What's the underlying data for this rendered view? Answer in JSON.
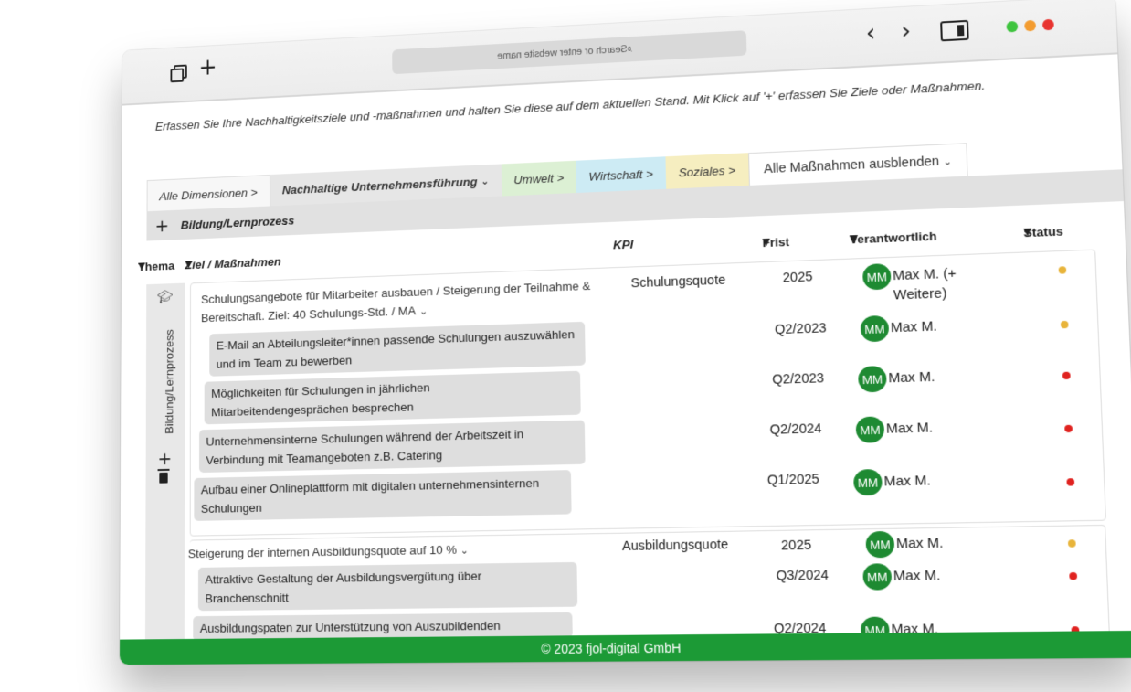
{
  "browser": {
    "address_placeholder": "Search or enter website name",
    "icons": [
      "tabs-icon",
      "new-tab-icon",
      "back-icon",
      "forward-icon",
      "sidebar-icon"
    ],
    "window_dots": [
      "#3fc43f",
      "#f39c30",
      "#e8332f"
    ]
  },
  "intro": "Erfassen Sie Ihre Nachhaltigkeitsziele und -maßnahmen und halten Sie diese auf dem aktuellen Stand. Mit Klick auf '+' erfassen Sie Ziele oder Maßnahmen.",
  "tabs": {
    "all": "Alle Dimensionen >",
    "nu": "Nachhaltige Unternehmensführung",
    "um": "Umwelt >",
    "wi": "Wirtschaft >",
    "so": "Soziales >",
    "hide": "Alle Maßnahmen ausblenden"
  },
  "subbar": {
    "add": "+",
    "label": "Bildung/Lernprozess"
  },
  "table_header": {
    "thema": "Thema",
    "ziel": "Ziel / Maßnahmen",
    "kpi": "KPI",
    "frist": "Frist",
    "verantwortlich": "Verantwortlich",
    "status": "Status"
  },
  "side": {
    "label": "Bildung/Lernprozess",
    "add": "+"
  },
  "groups": [
    {
      "goal": "Schulungsangebote für Mitarbeiter ausbauen / Steigerung der Teilnahme & Bereitschaft. Ziel: 40 Schulungs-Std. / MA",
      "kpi": "Schulungsquote",
      "frist": "2025",
      "initials": "MM",
      "resp": "Max M. (+ Weitere)",
      "status": "#e8b43a",
      "measures": [
        {
          "text": "E-Mail an Abteilungsleiter*innen passende Schulungen auszuwählen und im Team zu bewerben",
          "frist": "Q2/2023",
          "initials": "MM",
          "resp": "Max M.",
          "status": "#e8b43a"
        },
        {
          "text": "Möglichkeiten für Schulungen in jährlichen Mitarbeitendengesprächen besprechen",
          "frist": "Q2/2023",
          "initials": "MM",
          "resp": "Max M.",
          "status": "#e0221f"
        },
        {
          "text": "Unternehmensinterne Schulungen während der Arbeitszeit in Verbindung mit Teamangeboten z.B. Catering",
          "frist": "Q2/2024",
          "initials": "MM",
          "resp": "Max M.",
          "status": "#e0221f"
        },
        {
          "text": "Aufbau einer Onlineplattform mit digitalen unternehmensinternen Schulungen",
          "frist": "Q1/2025",
          "initials": "MM",
          "resp": "Max M.",
          "status": "#e0221f"
        }
      ]
    },
    {
      "goal": "Steigerung der internen Ausbildungsquote auf 10 %",
      "kpi": "Ausbildungsquote",
      "frist": "2025",
      "initials": "MM",
      "resp": "Max M.",
      "status": "#e8b43a",
      "measures": [
        {
          "text": "Attraktive Gestaltung der Ausbildungsvergütung über Branchenschnitt",
          "frist": "Q3/2024",
          "initials": "MM",
          "resp": "Max M.",
          "status": "#e0221f"
        },
        {
          "text": "Ausbildungspaten zur Unterstützung von Auszubildenden",
          "frist": "Q2/2024",
          "initials": "MM",
          "resp": "Max M.",
          "status": "#e0221f"
        }
      ]
    }
  ],
  "footer": "© 2023 fjol-digital GmbH"
}
